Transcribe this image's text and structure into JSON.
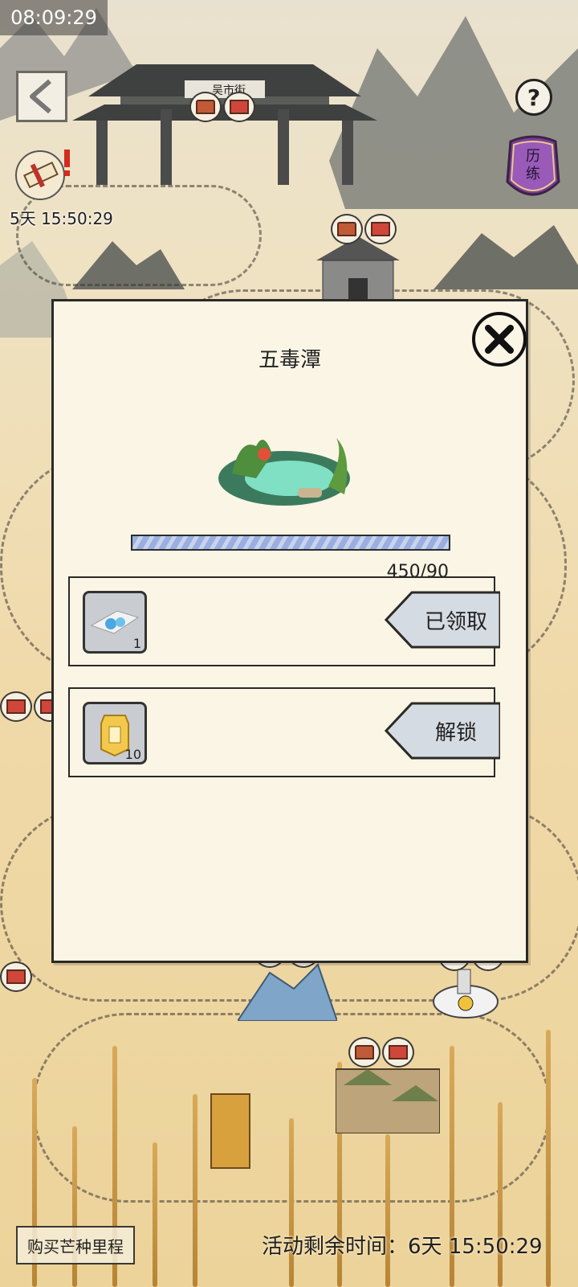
{
  "status_bar": {
    "time": "08:09:29"
  },
  "map": {
    "gate_sign": "吴市街",
    "left_timer": "5天 15:50:29",
    "trial_label": "历练",
    "buy_button": "购买芒种里程",
    "event_time_label": "活动剩余时间：",
    "event_time_value": "6天 15:50:29"
  },
  "dialog": {
    "title": "五毒潭",
    "progress": {
      "current": 450,
      "target": 90,
      "fraction": 1.0,
      "text": "450/90"
    },
    "rewards": [
      {
        "item": "jade-pendant",
        "count": "1",
        "button": "已领取",
        "claimed": true
      },
      {
        "item": "gold-token",
        "count": "10",
        "button": "解锁",
        "claimed": false
      }
    ]
  },
  "icons": {
    "back": "back-arrow-icon",
    "help": "question-mark-icon",
    "close": "close-x-icon",
    "scroll": "scroll-quest-icon",
    "trial": "trial-badge-icon"
  }
}
